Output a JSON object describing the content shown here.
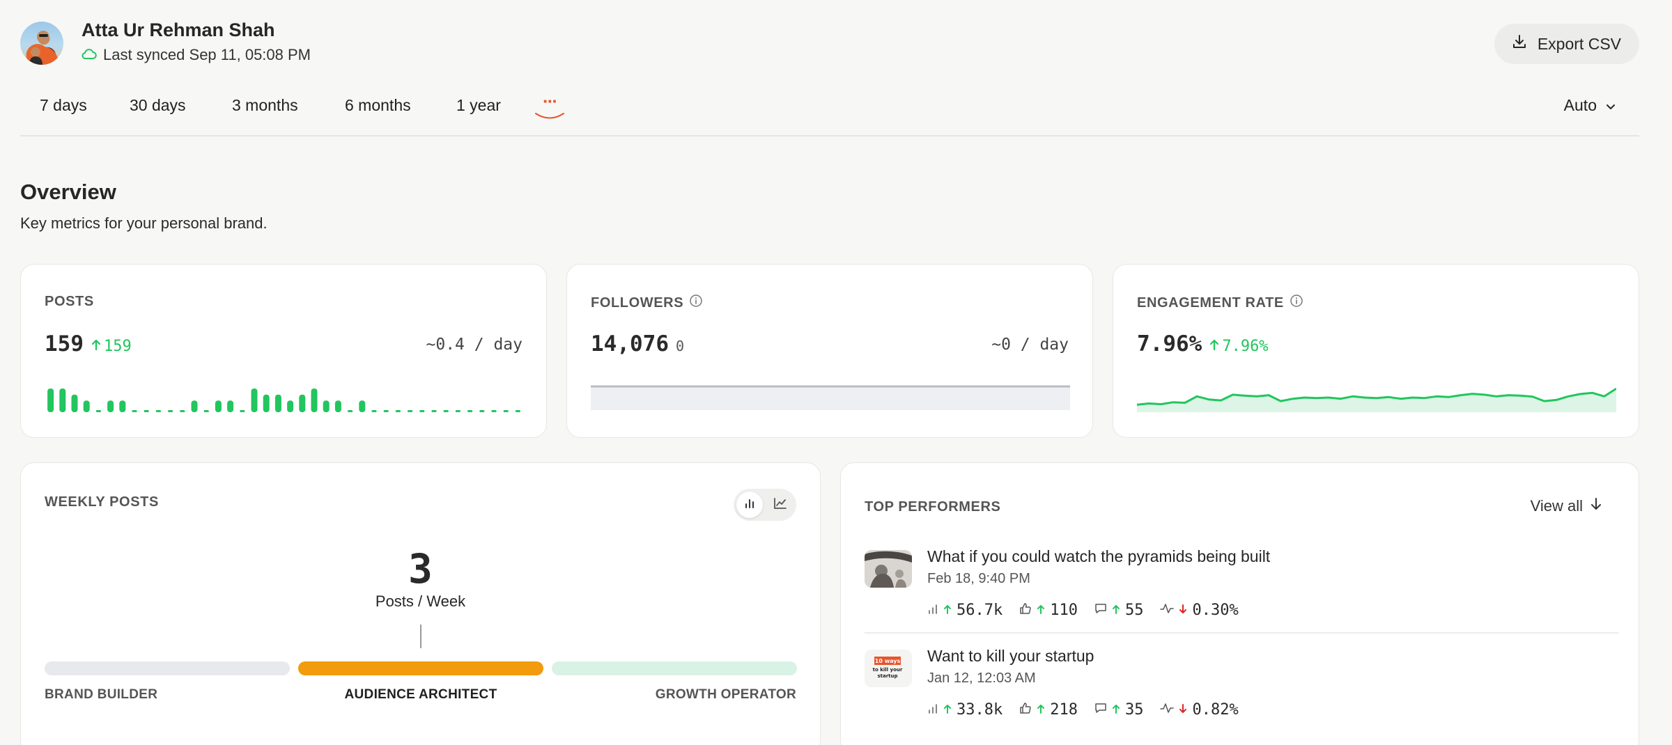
{
  "header": {
    "user_name": "Atta Ur Rehman Shah",
    "sync_status": "Last synced Sep 11, 05:08 PM",
    "export_label": "Export CSV"
  },
  "tabs": {
    "items": [
      "7 days",
      "30 days",
      "3 months",
      "6 months",
      "1 year"
    ],
    "more_label": "···",
    "active": "···",
    "auto_label": "Auto"
  },
  "overview": {
    "title": "Overview",
    "subtitle": "Key metrics for your personal brand."
  },
  "metrics": {
    "posts": {
      "label": "POSTS",
      "value": "159",
      "delta": "159",
      "rate": "~0.4 / day",
      "daily_bars": [
        3,
        3,
        2,
        1,
        0,
        1,
        1,
        0,
        0,
        0,
        0,
        0,
        1,
        0,
        1,
        1,
        0,
        3,
        2,
        2,
        1,
        2,
        3,
        1,
        1,
        0,
        1,
        0,
        0,
        0,
        0,
        0,
        0,
        0,
        0,
        0,
        0,
        0,
        0,
        0
      ]
    },
    "followers": {
      "label": "FOLLOWERS",
      "value": "14,076",
      "delta": "0",
      "rate": "~0 / day"
    },
    "engagement": {
      "label": "ENGAGEMENT RATE",
      "value": "7.96%",
      "delta": "7.96%",
      "trend": [
        0.2,
        0.25,
        0.22,
        0.3,
        0.28,
        0.55,
        0.42,
        0.38,
        0.62,
        0.58,
        0.55,
        0.6,
        0.35,
        0.45,
        0.5,
        0.48,
        0.5,
        0.45,
        0.55,
        0.5,
        0.48,
        0.52,
        0.45,
        0.5,
        0.48,
        0.55,
        0.52,
        0.6,
        0.66,
        0.62,
        0.55,
        0.6,
        0.58,
        0.54,
        0.35,
        0.4,
        0.55,
        0.65,
        0.7,
        0.55,
        0.88
      ]
    }
  },
  "weekly": {
    "label": "WEEKLY POSTS",
    "value": "3",
    "unit": "Posts / Week",
    "tiers": [
      "BRAND BUILDER",
      "AUDIENCE ARCHITECT",
      "GROWTH OPERATOR"
    ],
    "active_tier": "AUDIENCE ARCHITECT"
  },
  "top_performers": {
    "label": "TOP PERFORMERS",
    "view_all": "View all",
    "posts": [
      {
        "title": "What if you could watch the pyramids being built",
        "date": "Feb 18, 9:40 PM",
        "impressions": "56.7k",
        "likes": "110",
        "comments": "55",
        "engagement": "0.30%"
      },
      {
        "title": "Want to kill your startup",
        "date": "Jan 12, 12:03 AM",
        "impressions": "33.8k",
        "likes": "218",
        "comments": "35",
        "engagement": "0.82%"
      }
    ],
    "thumb2_text": [
      "10 ways",
      "to kill your",
      "startup"
    ]
  },
  "colors": {
    "green": "#22c55e",
    "red": "#dc2626",
    "orange": "#f59e0b",
    "accent": "#e8542a"
  }
}
